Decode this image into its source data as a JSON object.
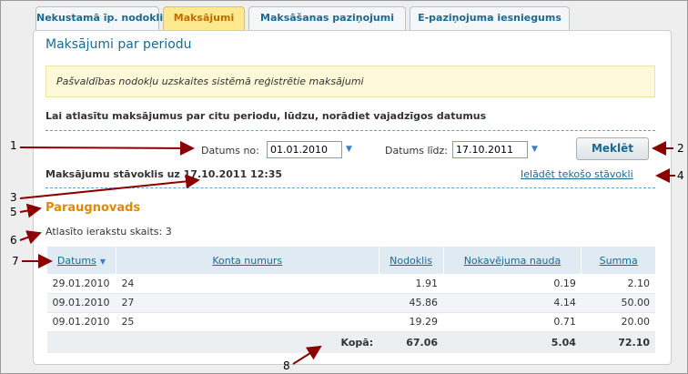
{
  "tabs": [
    {
      "label": "Nekustamā īp. nodoklis"
    },
    {
      "label": "Maksājumi"
    },
    {
      "label": "Maksāšanas paziņojumi"
    },
    {
      "label": "E-paziņojuma iesniegums"
    }
  ],
  "panel": {
    "title": "Maksājumi par periodu",
    "info": "Pašvaldības nodokļu uzskaites sistēmā reģistrētie maksājumi",
    "note": "Lai atlasītu maksājumus par citu periodu, lūdzu, norādiet vajadzīgos datumus"
  },
  "filter": {
    "from_label": "Datums no:",
    "from_value": "01.01.2010",
    "to_label": "Datums līdz:",
    "to_value": "17.10.2011",
    "search_label": "Meklēt"
  },
  "status": {
    "text": "Maksājumu stāvoklis uz 17.10.2011 12:35",
    "reload_link": "Ielādēt tekošo stāvokli"
  },
  "region": "Paraugnovads",
  "count_text": "Atlasīto ierakstu skaits: 3",
  "table": {
    "headers": {
      "date": "Datums",
      "account": "Konta numurs",
      "tax": "Nodoklis",
      "penalty": "Nokavējuma nauda",
      "sum": "Summa"
    },
    "rows": [
      {
        "date": "29.01.2010",
        "account": "24",
        "tax": "1.91",
        "penalty": "0.19",
        "sum": "2.10"
      },
      {
        "date": "09.01.2010",
        "account": "27",
        "tax": "45.86",
        "penalty": "4.14",
        "sum": "50.00"
      },
      {
        "date": "09.01.2010",
        "account": "25",
        "tax": "19.29",
        "penalty": "0.71",
        "sum": "20.00"
      }
    ],
    "total": {
      "label": "Kopā:",
      "tax": "67.06",
      "penalty": "5.04",
      "sum": "72.10"
    }
  },
  "annotations": {
    "n1": "1",
    "n2": "2",
    "n3": "3",
    "n4": "4",
    "n5": "5",
    "n6": "6",
    "n7": "7",
    "n8": "8"
  },
  "colors": {
    "accent": "#1a6a90",
    "active_tab": "#fce98e",
    "region": "#e08a00",
    "annotation_arrow": "#8b0000"
  },
  "icons": {
    "calendar": "calendar-dropdown-icon",
    "sort": "sort-desc-icon"
  }
}
